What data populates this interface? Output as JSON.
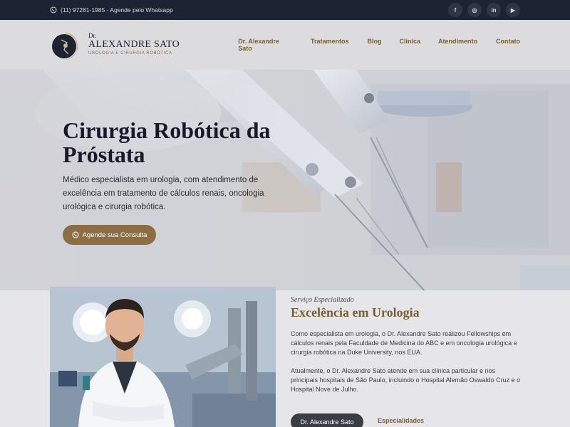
{
  "topbar": {
    "contact_text": "(11) 97281-1985 - Agende pelo Whatsapp",
    "socials": [
      "facebook-icon",
      "instagram-icon",
      "linkedin-icon",
      "youtube-icon"
    ],
    "social_glyphs": [
      "f",
      "◎",
      "in",
      "▶"
    ]
  },
  "logo": {
    "dr": "Dr.",
    "name": "ALEXANDRE SATO",
    "subtitle": "UROLOGIA E CIRURGIA ROBÓTICA"
  },
  "nav": {
    "items": [
      "Dr. Alexandre Sato",
      "Tratamentos",
      "Blog",
      "Clínica",
      "Atendimento",
      "Contato"
    ]
  },
  "hero": {
    "title": "Cirurgia Robótica da Próstata",
    "text": "Médico especialista em urologia, com atendimento de excelência em tratamento de cálculos renais, oncologia urológica e cirurgia robótica.",
    "cta": "Agende sua Consulta"
  },
  "about": {
    "label": "Serviço Especializado",
    "title": "Excelência em Urologia",
    "paragraph1": "Como especialista em urologia, o Dr. Alexandre Sato realizou Fellowships em cálculos renais pela Faculdade de Medicina do ABC e em oncologia urológica e cirurgia robótica na Duke University, nos EUA.",
    "paragraph2": "Atualmente, o Dr. Alexandre Sato atende em sua clínica particular e nos principais hospitais de São Paulo, incluindo o Hospital Alemão Oswaldo Cruz e o Hospital Nove de Julho.",
    "button_primary": "Dr. Alexandre Sato",
    "button_secondary": "Especialidades"
  },
  "colors": {
    "navy": "#1c2333",
    "gold": "#8d6e44",
    "gold_text": "#7a5e35"
  }
}
